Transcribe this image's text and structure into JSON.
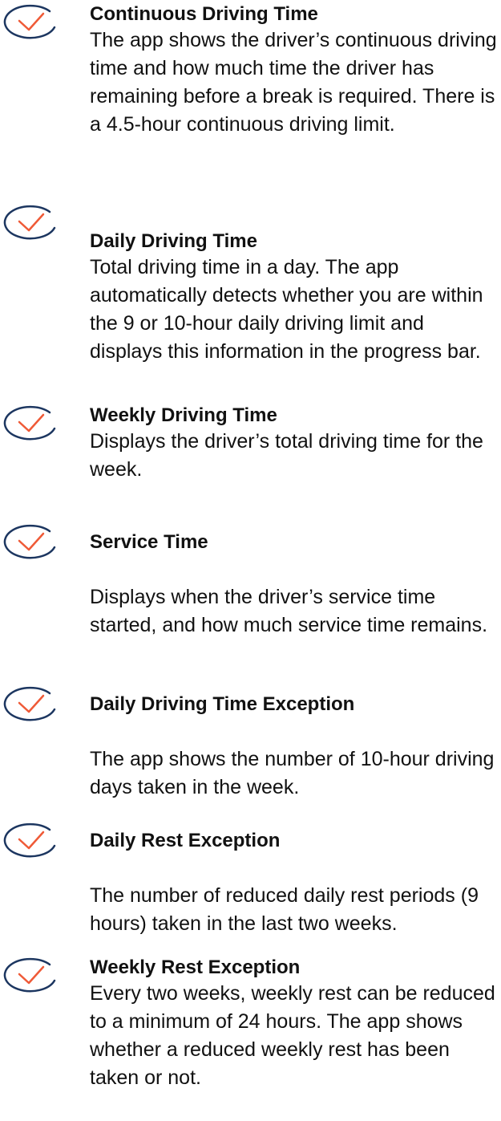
{
  "colors": {
    "icon_circle": "#1c3660",
    "icon_check": "#ef5a37",
    "text": "#111111",
    "background": "#ffffff"
  },
  "icons": {
    "item_icon": "check-circle-icon"
  },
  "features": [
    {
      "title": "Continuous Driving Time",
      "description": "The app shows the driver’s continuous driving time and how much time the driver has remaining before a break is required. There is a 4.5-hour continuous driving limit."
    },
    {
      "title": "Daily Driving Time",
      "description": "Total driving time in a day. The app automatically detects whether you are within the 9 or 10-hour daily driving limit and displays this information in the progress bar."
    },
    {
      "title": "Weekly Driving Time",
      "description": "Displays the driver’s total driving time for the week."
    },
    {
      "title": "Service Time",
      "description": "Displays when the driver’s service time started, and how much service time remains."
    },
    {
      "title": "Daily Driving Time Exception",
      "description": "The app shows the number of 10-hour driving days taken in the week."
    },
    {
      "title": "Daily Rest Exception",
      "description": "The number of reduced daily rest periods (9 hours) taken in the last two weeks."
    },
    {
      "title": "Weekly Rest Exception",
      "description": "Every two weeks, weekly rest can be reduced to a minimum of 24 hours. The app shows whether a reduced weekly rest has been taken or not."
    }
  ]
}
